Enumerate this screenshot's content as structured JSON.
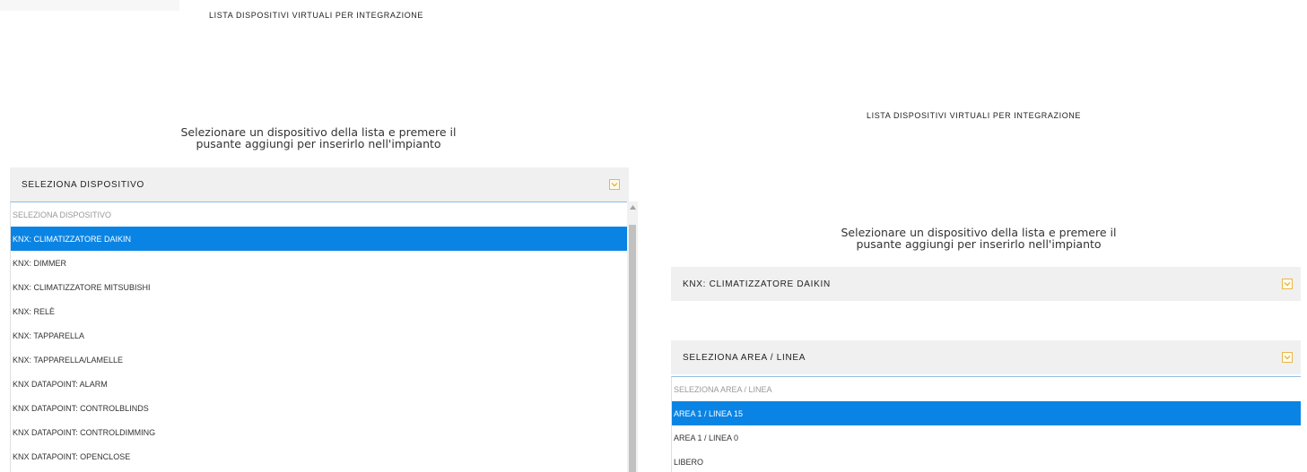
{
  "left": {
    "title": "LISTA DISPOSITIVI VIRTUALI PER INTEGRAZIONE",
    "instructions": "Selezionare un dispositivo della lista e premere il\npusante aggiungi per inserirlo nell'impianto",
    "select": {
      "label": "SELEZIONA DISPOSITIVO",
      "placeholder": "SELEZIONA DISPOSITIVO",
      "options": [
        "KNX: CLIMATIZZATORE DAIKIN",
        "KNX: DIMMER",
        "KNX: CLIMATIZZATORE MITSUBISHI",
        "KNX: RELÈ",
        "KNX: TAPPARELLA",
        "KNX: TAPPARELLA/LAMELLE",
        "KNX DATAPOINT: ALARM",
        "KNX DATAPOINT: CONTROLBLINDS",
        "KNX DATAPOINT: CONTROLDIMMING",
        "KNX DATAPOINT: OPENCLOSE"
      ],
      "selected": "KNX: CLIMATIZZATORE DAIKIN"
    }
  },
  "right": {
    "title": "LISTA DISPOSITIVI VIRTUALI PER INTEGRAZIONE",
    "instructions": "Selezionare un dispositivo della lista e premere il\npusante aggiungi per inserirlo nell'impianto",
    "device_select": {
      "label": "KNX: CLIMATIZZATORE DAIKIN"
    },
    "area_select": {
      "label": "SELEZIONA AREA / LINEA",
      "placeholder": "SELEZIONA AREA / LINEA",
      "options": [
        "AREA 1 / LINEA 15",
        "AREA 1 / LINEA 0",
        "LIBERO"
      ],
      "selected": "AREA 1 / LINEA 15"
    }
  },
  "colors": {
    "selected_bg": "#0a84e4",
    "header_bg": "#f0f0f0",
    "chevron_accent": "#e8b84a"
  },
  "icons": {
    "dropdown": "chevron-down-icon"
  }
}
